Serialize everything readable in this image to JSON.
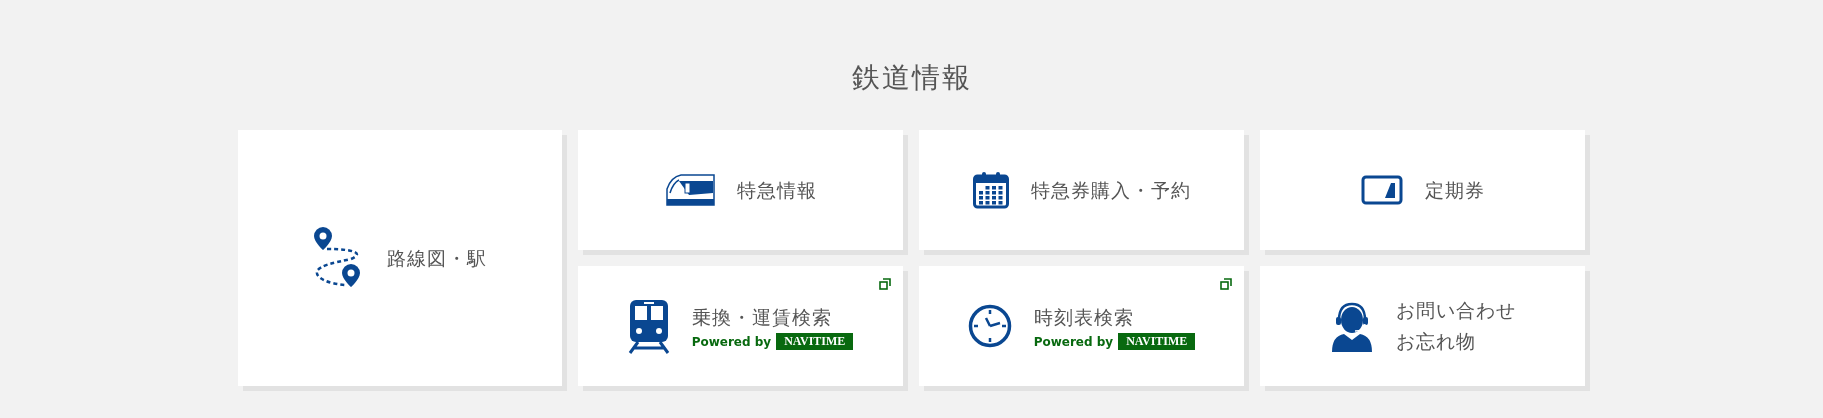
{
  "heading": "鉄道情報",
  "cards": [
    {
      "kind": "route",
      "lines": [
        "路線図・駅"
      ],
      "external": false
    },
    {
      "kind": "express",
      "lines": [
        "特急情報"
      ],
      "external": false
    },
    {
      "kind": "calendar",
      "lines": [
        "特急券購入・予約"
      ],
      "external": false
    },
    {
      "kind": "pass",
      "lines": [
        "定期券"
      ],
      "external": false
    },
    {
      "kind": "transfer",
      "lines": [
        "乗換・運賃検索"
      ],
      "external": true,
      "powered_by": {
        "text": "Powered by",
        "brand": "NAVITIME"
      }
    },
    {
      "kind": "timetable",
      "lines": [
        "時刻表検索"
      ],
      "external": true,
      "powered_by": {
        "text": "Powered by",
        "brand": "NAVITIME"
      }
    },
    {
      "kind": "contact",
      "lines": [
        "お問い合わせ",
        "お忘れ物"
      ],
      "external": false
    }
  ]
}
